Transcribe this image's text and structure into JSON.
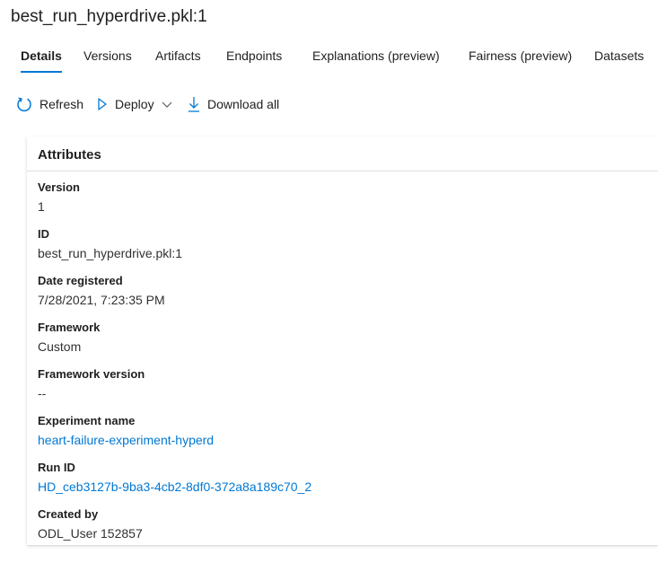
{
  "page": {
    "title": "best_run_hyperdrive.pkl:1"
  },
  "tabs": [
    {
      "label": "Details",
      "active": true
    },
    {
      "label": "Versions"
    },
    {
      "label": "Artifacts"
    },
    {
      "label": "Endpoints"
    },
    {
      "label": "Explanations (preview)"
    },
    {
      "label": "Fairness (preview)"
    },
    {
      "label": "Datasets"
    }
  ],
  "toolbar": {
    "refresh_label": "Refresh",
    "deploy_label": "Deploy",
    "download_label": "Download all"
  },
  "attributes": {
    "heading": "Attributes",
    "items": [
      {
        "key": "Version",
        "value": "1"
      },
      {
        "key": "ID",
        "value": "best_run_hyperdrive.pkl:1"
      },
      {
        "key": "Date registered",
        "value": "7/28/2021, 7:23:35 PM"
      },
      {
        "key": "Framework",
        "value": "Custom"
      },
      {
        "key": "Framework version",
        "value": "--"
      },
      {
        "key": "Experiment name",
        "value": "heart-failure-experiment-hyperd"
      },
      {
        "key": "Run ID",
        "value": "HD_ceb3127b-9ba3-4cb2-8df0-372a8a189c70_2"
      },
      {
        "key": "Created by",
        "value": "ODL_User 152857"
      }
    ]
  },
  "colors": {
    "accent": "#0078d4",
    "text": "#201f1e",
    "divider": "#e1dfdd"
  },
  "icons": {
    "refresh": "refresh-icon",
    "deploy": "play-icon",
    "chevron": "chevron-down-icon",
    "download": "download-icon"
  }
}
